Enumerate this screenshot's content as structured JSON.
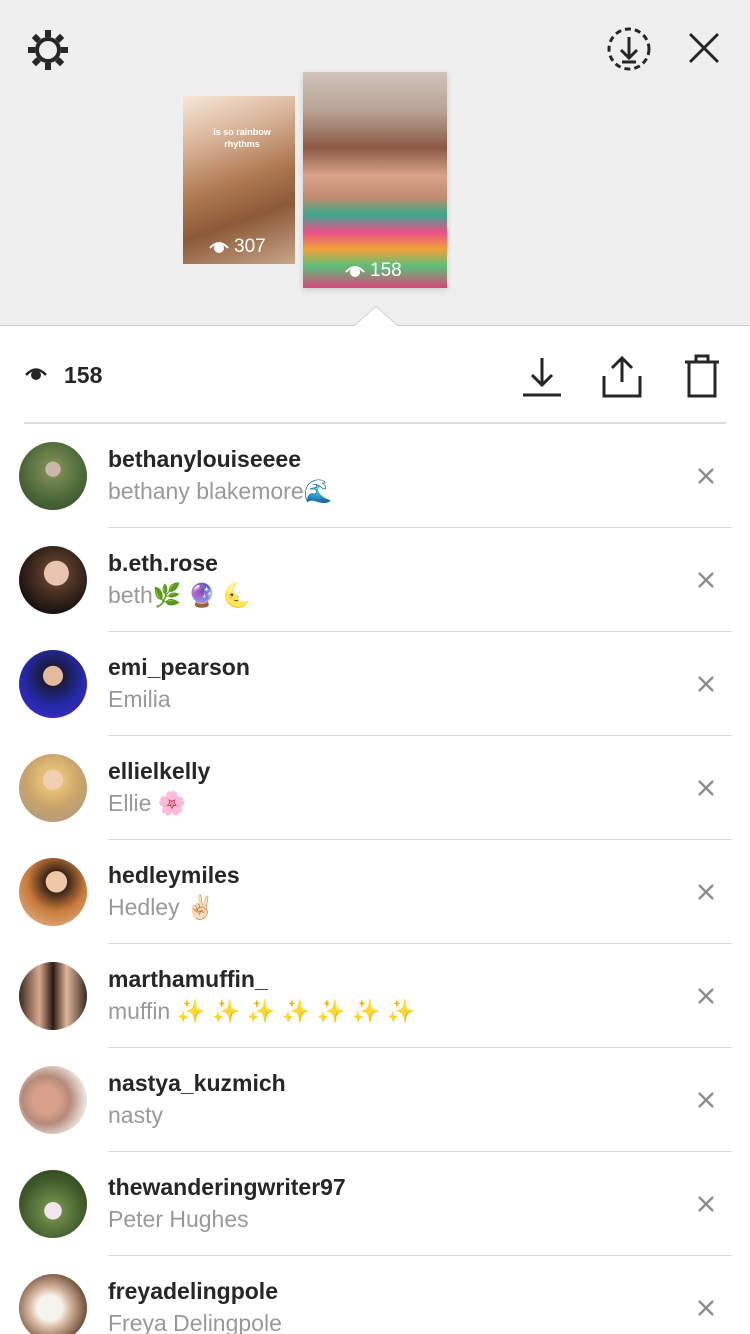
{
  "header": {
    "icons": {
      "settings": "gear-icon",
      "save": "save-circle-icon",
      "close": "close-icon"
    }
  },
  "stories": [
    {
      "caption": "is so rainbow rhythms",
      "views": "307"
    },
    {
      "caption": "",
      "views": "158"
    }
  ],
  "toolbar": {
    "view_count": "158",
    "icons": [
      "eye-icon",
      "download-icon",
      "share-icon",
      "trash-icon"
    ]
  },
  "viewers": [
    {
      "username": "bethanylouiseeee",
      "name": "bethany blakemore🌊"
    },
    {
      "username": "b.eth.rose",
      "name": "beth🌿 🔮 🌜"
    },
    {
      "username": "emi_pearson",
      "name": "Emilia"
    },
    {
      "username": "ellielkelly",
      "name": "Ellie 🌸"
    },
    {
      "username": "hedleymiles",
      "name": "Hedley ✌🏻"
    },
    {
      "username": "marthamuffin_",
      "name": "muffin ✨ ✨ ✨ ✨ ✨ ✨ ✨"
    },
    {
      "username": "nastya_kuzmich",
      "name": "nasty"
    },
    {
      "username": "thewanderingwriter97",
      "name": "Peter Hughes"
    },
    {
      "username": "freyadelingpole",
      "name": "Freya Delingpole"
    }
  ],
  "colors": {
    "top_background": "#efefef",
    "text_primary": "#262626",
    "text_secondary": "#999999",
    "divider": "#dbdbdb"
  }
}
